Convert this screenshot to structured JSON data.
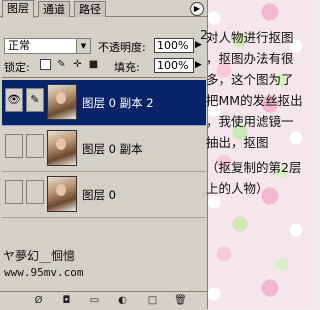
{
  "tabs": [
    {
      "label": "图层",
      "active": true
    },
    {
      "label": "通道",
      "active": false
    },
    {
      "label": "路径",
      "active": false
    }
  ],
  "blend_mode": "正常",
  "opacity_label": "不透明度:",
  "opacity_value": "100%",
  "lock_label": "锁定:",
  "fill_label": "填充:",
  "fill_value": "100%",
  "layers": [
    {
      "name": "图层 0 副本 2",
      "selected": true,
      "visible": true
    },
    {
      "name": "图层 0 副本",
      "selected": false,
      "visible": false
    },
    {
      "name": "图层 0",
      "selected": false,
      "visible": false
    }
  ],
  "credit": "ヤ夢幻__恛憶",
  "site": "www.95mv.com",
  "step": "2:",
  "note_lines": [
    "对人物进行抠图",
    "，抠图办法有很",
    "多，这个图为了",
    "把MM的发丝抠出",
    "，我使用滤镜一",
    "抽出，抠图",
    "（抠复制的第2层",
    "上的人物）"
  ],
  "icons": {
    "menu": "circle-arrow-icon",
    "eye": "eye-icon",
    "brush": "brush-icon"
  },
  "colors": {
    "panel": "#d4d0c8",
    "selection": "#0a246a"
  }
}
